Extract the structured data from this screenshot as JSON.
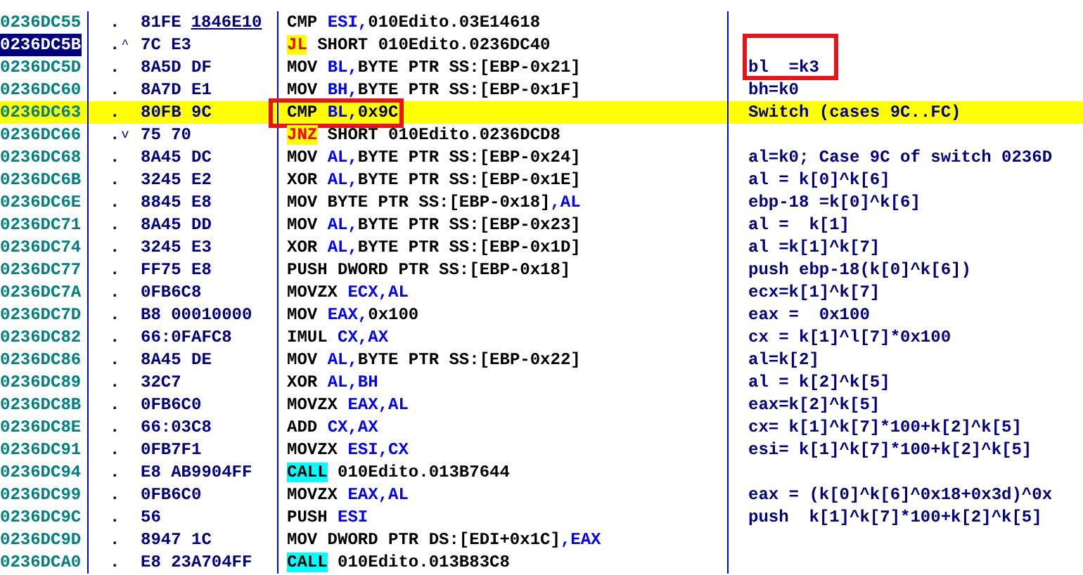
{
  "rows": [
    {
      "address": "0236DC55",
      "selected": false,
      "highlighted": false,
      "dot": ".",
      "hex": "81FE",
      "hex_fixup": "1846E10",
      "disasm": [
        {
          "text": "CMP ",
          "kind": "op"
        },
        {
          "text": "ESI,",
          "kind": "reg"
        },
        {
          "text": "010Edito.03E14618",
          "kind": "op"
        }
      ]
    },
    {
      "address": "0236DC5B",
      "selected": true,
      "highlighted": false,
      "dot": ".",
      "jump_arrow": "^",
      "hex": "7C E3",
      "disasm": [
        {
          "text": "JL",
          "kind": "jump"
        },
        {
          "text": " SHORT 010Edito.0236DC40",
          "kind": "op"
        }
      ]
    },
    {
      "address": "0236DC5D",
      "selected": false,
      "highlighted": false,
      "dot": ".",
      "hex": "8A5D DF",
      "disasm": [
        {
          "text": "MOV ",
          "kind": "op"
        },
        {
          "text": "BL,",
          "kind": "reg"
        },
        {
          "text": "BYTE PTR SS:[EBP-0x21]",
          "kind": "op"
        }
      ],
      "comment": "bl  =k3",
      "comment_outlined": true
    },
    {
      "address": "0236DC60",
      "selected": false,
      "highlighted": false,
      "dot": ".",
      "hex": "8A7D E1",
      "disasm": [
        {
          "text": "MOV ",
          "kind": "op"
        },
        {
          "text": "BH,",
          "kind": "reg"
        },
        {
          "text": "BYTE PTR SS:[EBP-0x1F]",
          "kind": "op"
        }
      ],
      "comment": "bh=k0"
    },
    {
      "address": "0236DC63",
      "selected": false,
      "highlighted": true,
      "dot": ".",
      "hex": "80FB 9C",
      "disasm": [
        {
          "text": "CMP ",
          "kind": "op"
        },
        {
          "text": "BL,",
          "kind": "reg"
        },
        {
          "text": "0x9C",
          "kind": "op"
        }
      ],
      "comment": "Switch (cases 9C..FC)",
      "disasm_outlined": true
    },
    {
      "address": "0236DC66",
      "selected": false,
      "highlighted": false,
      "dot": ".",
      "jump_arrow": "v",
      "hex": "75 70",
      "disasm": [
        {
          "text": "JNZ",
          "kind": "jump"
        },
        {
          "text": " SHORT 010Edito.0236DCD8",
          "kind": "op"
        }
      ]
    },
    {
      "address": "0236DC68",
      "selected": false,
      "highlighted": false,
      "dot": ".",
      "hex": "8A45 DC",
      "disasm": [
        {
          "text": "MOV ",
          "kind": "op"
        },
        {
          "text": "AL,",
          "kind": "reg"
        },
        {
          "text": "BYTE PTR SS:[EBP-0x24]",
          "kind": "op"
        }
      ],
      "comment": "al=k0; Case 9C of switch 0236D"
    },
    {
      "address": "0236DC6B",
      "selected": false,
      "highlighted": false,
      "dot": ".",
      "hex": "3245 E2",
      "disasm": [
        {
          "text": "XOR ",
          "kind": "op"
        },
        {
          "text": "AL,",
          "kind": "reg"
        },
        {
          "text": "BYTE PTR SS:[EBP-0x1E]",
          "kind": "op"
        }
      ],
      "comment": "al = k[0]^k[6]"
    },
    {
      "address": "0236DC6E",
      "selected": false,
      "highlighted": false,
      "dot": ".",
      "hex": "8845 E8",
      "disasm": [
        {
          "text": "MOV BYTE PTR SS:[EBP-0x18]",
          "kind": "op"
        },
        {
          "text": ",AL",
          "kind": "reg"
        }
      ],
      "comment": "ebp-18 =k[0]^k[6]"
    },
    {
      "address": "0236DC71",
      "selected": false,
      "highlighted": false,
      "dot": ".",
      "hex": "8A45 DD",
      "disasm": [
        {
          "text": "MOV ",
          "kind": "op"
        },
        {
          "text": "AL,",
          "kind": "reg"
        },
        {
          "text": "BYTE PTR SS:[EBP-0x23]",
          "kind": "op"
        }
      ],
      "comment": "al =  k[1]"
    },
    {
      "address": "0236DC74",
      "selected": false,
      "highlighted": false,
      "dot": ".",
      "hex": "3245 E3",
      "disasm": [
        {
          "text": "XOR ",
          "kind": "op"
        },
        {
          "text": "AL,",
          "kind": "reg"
        },
        {
          "text": "BYTE PTR SS:[EBP-0x1D]",
          "kind": "op"
        }
      ],
      "comment": "al =k[1]^k[7]"
    },
    {
      "address": "0236DC77",
      "selected": false,
      "highlighted": false,
      "dot": ".",
      "hex": "FF75 E8",
      "disasm": [
        {
          "text": "PUSH DWORD PTR SS:[EBP-0x18]",
          "kind": "op"
        }
      ],
      "comment": "push ebp-18(k[0]^k[6])"
    },
    {
      "address": "0236DC7A",
      "selected": false,
      "highlighted": false,
      "dot": ".",
      "hex": "0FB6C8",
      "disasm": [
        {
          "text": "MOVZX ",
          "kind": "op"
        },
        {
          "text": "ECX,AL",
          "kind": "reg"
        }
      ],
      "comment": "ecx=k[1]^k[7]"
    },
    {
      "address": "0236DC7D",
      "selected": false,
      "highlighted": false,
      "dot": ".",
      "hex": "B8 00010000",
      "disasm": [
        {
          "text": "MOV ",
          "kind": "op"
        },
        {
          "text": "EAX,",
          "kind": "reg"
        },
        {
          "text": "0x100",
          "kind": "op"
        }
      ],
      "comment": "eax =  0x100"
    },
    {
      "address": "0236DC82",
      "selected": false,
      "highlighted": false,
      "dot": ".",
      "hex": "66:0FAFC8",
      "disasm": [
        {
          "text": "IMUL ",
          "kind": "op"
        },
        {
          "text": "CX,AX",
          "kind": "reg"
        }
      ],
      "comment": "cx = k[1]^l[7]*0x100"
    },
    {
      "address": "0236DC86",
      "selected": false,
      "highlighted": false,
      "dot": ".",
      "hex": "8A45 DE",
      "disasm": [
        {
          "text": "MOV ",
          "kind": "op"
        },
        {
          "text": "AL,",
          "kind": "reg"
        },
        {
          "text": "BYTE PTR SS:[EBP-0x22]",
          "kind": "op"
        }
      ],
      "comment": "al=k[2]"
    },
    {
      "address": "0236DC89",
      "selected": false,
      "highlighted": false,
      "dot": ".",
      "hex": "32C7",
      "disasm": [
        {
          "text": "XOR ",
          "kind": "op"
        },
        {
          "text": "AL,BH",
          "kind": "reg"
        }
      ],
      "comment": "al = k[2]^k[5]"
    },
    {
      "address": "0236DC8B",
      "selected": false,
      "highlighted": false,
      "dot": ".",
      "hex": "0FB6C0",
      "disasm": [
        {
          "text": "MOVZX ",
          "kind": "op"
        },
        {
          "text": "EAX,AL",
          "kind": "reg"
        }
      ],
      "comment": "eax=k[2]^k[5]"
    },
    {
      "address": "0236DC8E",
      "selected": false,
      "highlighted": false,
      "dot": ".",
      "hex": "66:03C8",
      "disasm": [
        {
          "text": "ADD ",
          "kind": "op"
        },
        {
          "text": "CX,AX",
          "kind": "reg"
        }
      ],
      "comment": "cx= k[1]^k[7]*100+k[2]^k[5]"
    },
    {
      "address": "0236DC91",
      "selected": false,
      "highlighted": false,
      "dot": ".",
      "hex": "0FB7F1",
      "disasm": [
        {
          "text": "MOVZX ",
          "kind": "op"
        },
        {
          "text": "ESI,CX",
          "kind": "reg"
        }
      ],
      "comment": "esi= k[1]^k[7]*100+k[2]^k[5]"
    },
    {
      "address": "0236DC94",
      "selected": false,
      "highlighted": false,
      "dot": ".",
      "hex": "E8 AB9904FF",
      "disasm": [
        {
          "text": "CALL",
          "kind": "call"
        },
        {
          "text": " 010Edito.013B7644",
          "kind": "op"
        }
      ]
    },
    {
      "address": "0236DC99",
      "selected": false,
      "highlighted": false,
      "dot": ".",
      "hex": "0FB6C0",
      "disasm": [
        {
          "text": "MOVZX ",
          "kind": "op"
        },
        {
          "text": "EAX,AL",
          "kind": "reg"
        }
      ],
      "comment": "eax = (k[0]^k[6]^0x18+0x3d)^0x"
    },
    {
      "address": "0236DC9C",
      "selected": false,
      "highlighted": false,
      "dot": ".",
      "hex": "56",
      "disasm": [
        {
          "text": "PUSH ",
          "kind": "op"
        },
        {
          "text": "ESI",
          "kind": "reg"
        }
      ],
      "comment": "push  k[1]^k[7]*100+k[2]^k[5]"
    },
    {
      "address": "0236DC9D",
      "selected": false,
      "highlighted": false,
      "dot": ".",
      "hex": "8947 1C",
      "disasm": [
        {
          "text": "MOV DWORD PTR DS:[EDI+0x1C]",
          "kind": "op"
        },
        {
          "text": ",EAX",
          "kind": "reg"
        }
      ]
    },
    {
      "address": "0236DCA0",
      "selected": false,
      "highlighted": false,
      "dot": ".",
      "hex": "E8 23A704FF",
      "disasm": [
        {
          "text": "CALL",
          "kind": "call"
        },
        {
          "text": " 010Edito.013B83C8",
          "kind": "op"
        }
      ]
    }
  ]
}
